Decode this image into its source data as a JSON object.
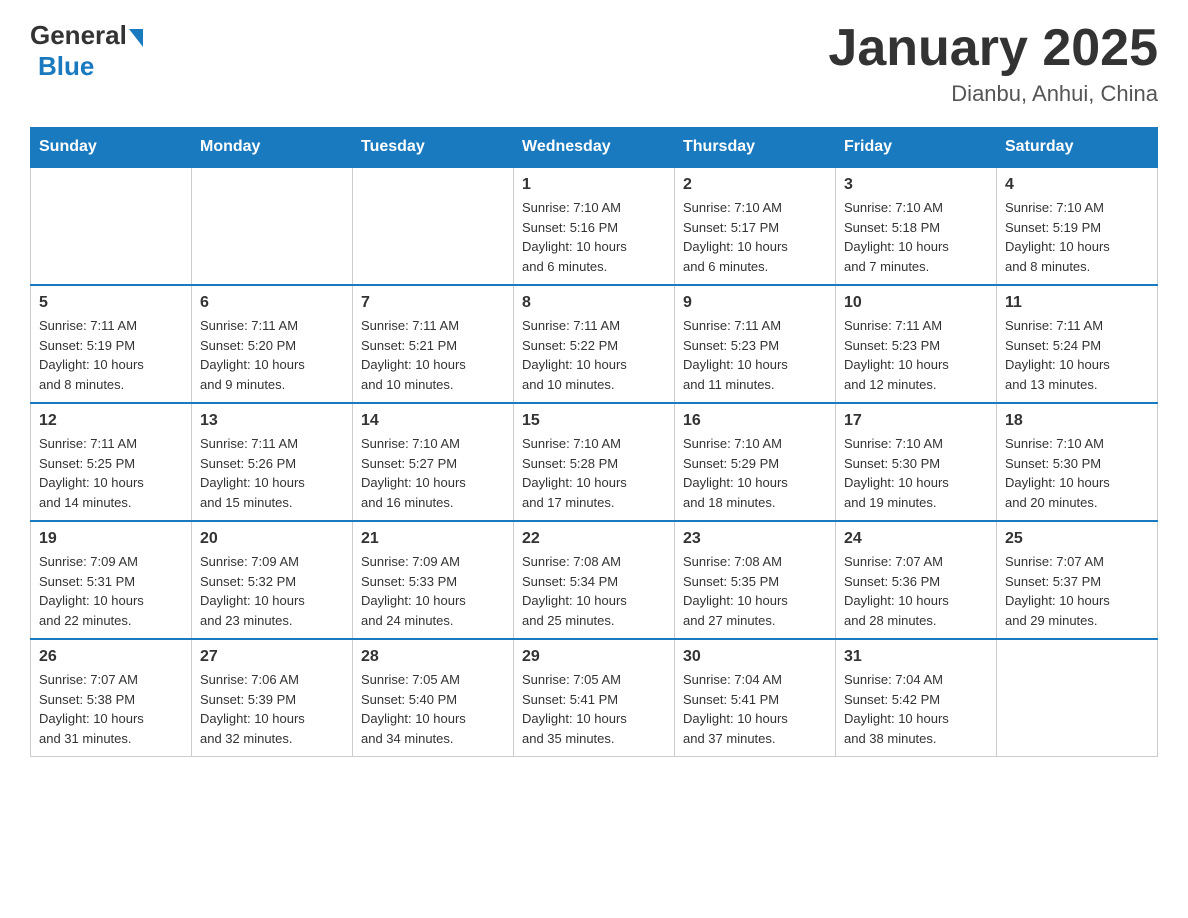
{
  "header": {
    "logo_general": "General",
    "logo_blue": "Blue",
    "title": "January 2025",
    "subtitle": "Dianbu, Anhui, China"
  },
  "weekdays": [
    "Sunday",
    "Monday",
    "Tuesday",
    "Wednesday",
    "Thursday",
    "Friday",
    "Saturday"
  ],
  "weeks": [
    [
      {
        "day": "",
        "info": ""
      },
      {
        "day": "",
        "info": ""
      },
      {
        "day": "",
        "info": ""
      },
      {
        "day": "1",
        "info": "Sunrise: 7:10 AM\nSunset: 5:16 PM\nDaylight: 10 hours\nand 6 minutes."
      },
      {
        "day": "2",
        "info": "Sunrise: 7:10 AM\nSunset: 5:17 PM\nDaylight: 10 hours\nand 6 minutes."
      },
      {
        "day": "3",
        "info": "Sunrise: 7:10 AM\nSunset: 5:18 PM\nDaylight: 10 hours\nand 7 minutes."
      },
      {
        "day": "4",
        "info": "Sunrise: 7:10 AM\nSunset: 5:19 PM\nDaylight: 10 hours\nand 8 minutes."
      }
    ],
    [
      {
        "day": "5",
        "info": "Sunrise: 7:11 AM\nSunset: 5:19 PM\nDaylight: 10 hours\nand 8 minutes."
      },
      {
        "day": "6",
        "info": "Sunrise: 7:11 AM\nSunset: 5:20 PM\nDaylight: 10 hours\nand 9 minutes."
      },
      {
        "day": "7",
        "info": "Sunrise: 7:11 AM\nSunset: 5:21 PM\nDaylight: 10 hours\nand 10 minutes."
      },
      {
        "day": "8",
        "info": "Sunrise: 7:11 AM\nSunset: 5:22 PM\nDaylight: 10 hours\nand 10 minutes."
      },
      {
        "day": "9",
        "info": "Sunrise: 7:11 AM\nSunset: 5:23 PM\nDaylight: 10 hours\nand 11 minutes."
      },
      {
        "day": "10",
        "info": "Sunrise: 7:11 AM\nSunset: 5:23 PM\nDaylight: 10 hours\nand 12 minutes."
      },
      {
        "day": "11",
        "info": "Sunrise: 7:11 AM\nSunset: 5:24 PM\nDaylight: 10 hours\nand 13 minutes."
      }
    ],
    [
      {
        "day": "12",
        "info": "Sunrise: 7:11 AM\nSunset: 5:25 PM\nDaylight: 10 hours\nand 14 minutes."
      },
      {
        "day": "13",
        "info": "Sunrise: 7:11 AM\nSunset: 5:26 PM\nDaylight: 10 hours\nand 15 minutes."
      },
      {
        "day": "14",
        "info": "Sunrise: 7:10 AM\nSunset: 5:27 PM\nDaylight: 10 hours\nand 16 minutes."
      },
      {
        "day": "15",
        "info": "Sunrise: 7:10 AM\nSunset: 5:28 PM\nDaylight: 10 hours\nand 17 minutes."
      },
      {
        "day": "16",
        "info": "Sunrise: 7:10 AM\nSunset: 5:29 PM\nDaylight: 10 hours\nand 18 minutes."
      },
      {
        "day": "17",
        "info": "Sunrise: 7:10 AM\nSunset: 5:30 PM\nDaylight: 10 hours\nand 19 minutes."
      },
      {
        "day": "18",
        "info": "Sunrise: 7:10 AM\nSunset: 5:30 PM\nDaylight: 10 hours\nand 20 minutes."
      }
    ],
    [
      {
        "day": "19",
        "info": "Sunrise: 7:09 AM\nSunset: 5:31 PM\nDaylight: 10 hours\nand 22 minutes."
      },
      {
        "day": "20",
        "info": "Sunrise: 7:09 AM\nSunset: 5:32 PM\nDaylight: 10 hours\nand 23 minutes."
      },
      {
        "day": "21",
        "info": "Sunrise: 7:09 AM\nSunset: 5:33 PM\nDaylight: 10 hours\nand 24 minutes."
      },
      {
        "day": "22",
        "info": "Sunrise: 7:08 AM\nSunset: 5:34 PM\nDaylight: 10 hours\nand 25 minutes."
      },
      {
        "day": "23",
        "info": "Sunrise: 7:08 AM\nSunset: 5:35 PM\nDaylight: 10 hours\nand 27 minutes."
      },
      {
        "day": "24",
        "info": "Sunrise: 7:07 AM\nSunset: 5:36 PM\nDaylight: 10 hours\nand 28 minutes."
      },
      {
        "day": "25",
        "info": "Sunrise: 7:07 AM\nSunset: 5:37 PM\nDaylight: 10 hours\nand 29 minutes."
      }
    ],
    [
      {
        "day": "26",
        "info": "Sunrise: 7:07 AM\nSunset: 5:38 PM\nDaylight: 10 hours\nand 31 minutes."
      },
      {
        "day": "27",
        "info": "Sunrise: 7:06 AM\nSunset: 5:39 PM\nDaylight: 10 hours\nand 32 minutes."
      },
      {
        "day": "28",
        "info": "Sunrise: 7:05 AM\nSunset: 5:40 PM\nDaylight: 10 hours\nand 34 minutes."
      },
      {
        "day": "29",
        "info": "Sunrise: 7:05 AM\nSunset: 5:41 PM\nDaylight: 10 hours\nand 35 minutes."
      },
      {
        "day": "30",
        "info": "Sunrise: 7:04 AM\nSunset: 5:41 PM\nDaylight: 10 hours\nand 37 minutes."
      },
      {
        "day": "31",
        "info": "Sunrise: 7:04 AM\nSunset: 5:42 PM\nDaylight: 10 hours\nand 38 minutes."
      },
      {
        "day": "",
        "info": ""
      }
    ]
  ]
}
